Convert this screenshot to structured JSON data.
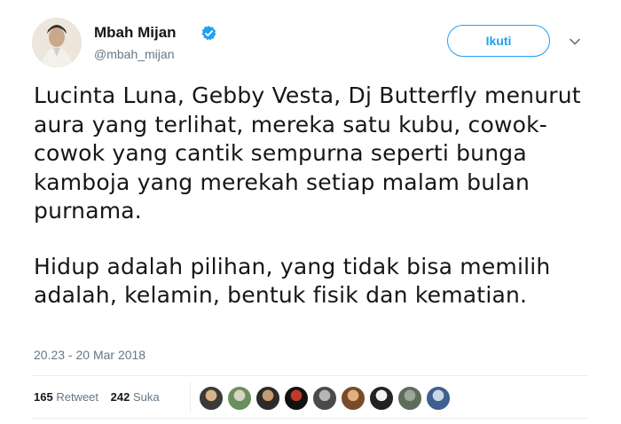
{
  "author": {
    "display_name": "Mbah Mijan",
    "handle": "@mbah_mijan",
    "verified": true
  },
  "actions": {
    "follow_label": "Ikuti"
  },
  "tweet": {
    "paragraphs": [
      "Lucinta Luna, Gebby Vesta, Dj Butterfly menurut aura yang terlihat, mereka satu kubu, cowok-cowok yang cantik sempurna seperti bunga kamboja yang merekah setiap malam bulan purnama.",
      "Hidup adalah pilihan, yang tidak bisa memilih adalah, kelamin, bentuk fisik dan kematian."
    ],
    "timestamp": "20.23 - 20 Mar 2018"
  },
  "stats": {
    "retweets_count": "165",
    "retweets_label": "Retweet",
    "likes_count": "242",
    "likes_label": "Suka"
  },
  "colors": {
    "accent": "#1da1f2",
    "secondary_text": "#657786",
    "divider": "#e6ecf0"
  },
  "likers": [
    {
      "color_a": "#3a3a3a",
      "color_b": "#d9b48a"
    },
    {
      "color_a": "#6b8f5e",
      "color_b": "#d7d2c8"
    },
    {
      "color_a": "#2b2b2b",
      "color_b": "#c49a73"
    },
    {
      "color_a": "#111111",
      "color_b": "#c0392b"
    },
    {
      "color_a": "#4a4a4a",
      "color_b": "#b5b5b5"
    },
    {
      "color_a": "#7a4a2a",
      "color_b": "#e0b080"
    },
    {
      "color_a": "#222222",
      "color_b": "#f2f2f2"
    },
    {
      "color_a": "#5d6d5a",
      "color_b": "#9aa79a"
    },
    {
      "color_a": "#3f5f8f",
      "color_b": "#c9d6e8"
    }
  ]
}
